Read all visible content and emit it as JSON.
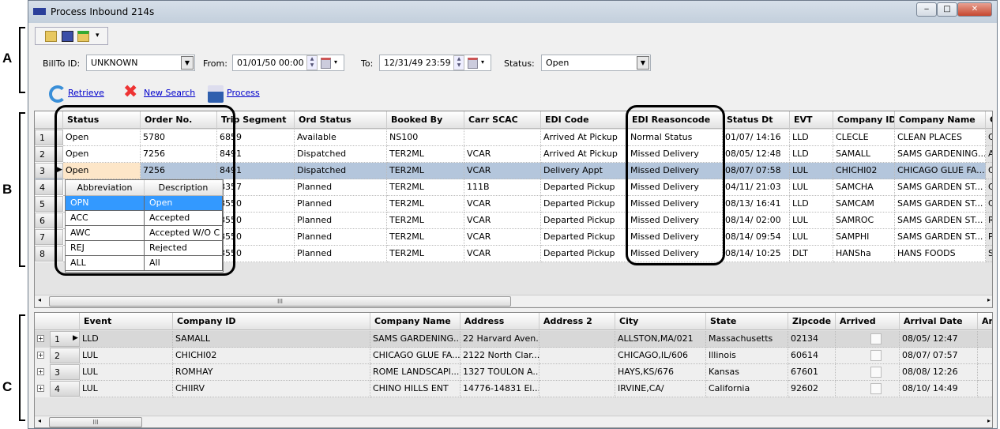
{
  "window": {
    "title": "Process Inbound 214s",
    "logo": "TMW",
    "minimize": "‒",
    "maximize": "□",
    "close": "✕"
  },
  "toolbar": {
    "icons": [
      "new-folder-icon",
      "save-icon",
      "export-icon"
    ],
    "overflow": "▾"
  },
  "filters": {
    "billto_label": "BillTo ID:",
    "billto_value": "UNKNOWN",
    "from_label": "From:",
    "from_value": "01/01/50 00:00",
    "to_label": "To:",
    "to_value": "12/31/49 23:59",
    "status_label": "Status:",
    "status_value": "Open"
  },
  "actions": {
    "retrieve": "Retrieve",
    "new_search": "New Search",
    "process": "Process"
  },
  "annotations": {
    "a": "A",
    "b": "B",
    "c": "C"
  },
  "top_grid": {
    "columns": [
      "Status",
      "Order No.",
      "Trip Segment",
      "Ord Status",
      "Booked By",
      "Carr SCAC",
      "EDI Code",
      "EDI Reasoncode",
      "Status Dt",
      "EVT",
      "Company ID",
      "Company Name",
      "C"
    ],
    "rows": [
      [
        "Open",
        "5780",
        "6859",
        "Available",
        "NS100",
        "",
        "Arrived At Pickup",
        "Normal Status",
        "01/07/ 14:16",
        "LLD",
        "CLECLE",
        "CLEAN PLACES",
        "C"
      ],
      [
        "Open",
        "7256",
        "8491",
        "Dispatched",
        "TER2ML",
        "VCAR",
        "Arrived At Pickup",
        "Missed Delivery",
        "08/05/ 12:48",
        "LLD",
        "SAMALL",
        "SAMS GARDENING...",
        "A"
      ],
      [
        "Open",
        "7256",
        "8491",
        "Dispatched",
        "TER2ML",
        "VCAR",
        "Delivery Appt",
        "Missed Delivery",
        "08/07/ 07:58",
        "LUL",
        "CHICHI02",
        "CHICAGO GLUE FA...",
        "C"
      ],
      [
        "",
        "",
        "8357",
        "Planned",
        "TER2ML",
        "111B",
        "Departed Pickup",
        "Missed Delivery",
        "04/11/ 21:03",
        "LUL",
        "SAMCHA",
        "SAMS GARDEN ST...",
        "C"
      ],
      [
        "",
        "",
        "8550",
        "Planned",
        "TER2ML",
        "VCAR",
        "Departed Pickup",
        "Missed Delivery",
        "08/13/ 16:41",
        "LLD",
        "SAMCAM",
        "SAMS GARDEN ST...",
        "C"
      ],
      [
        "",
        "",
        "8550",
        "Planned",
        "TER2ML",
        "VCAR",
        "Departed Pickup",
        "Missed Delivery",
        "08/14/ 02:00",
        "LUL",
        "SAMROC",
        "SAMS GARDEN ST...",
        "R"
      ],
      [
        "",
        "",
        "8550",
        "Planned",
        "TER2ML",
        "VCAR",
        "Departed Pickup",
        "Missed Delivery",
        "08/14/ 09:54",
        "LUL",
        "SAMPHI",
        "SAMS GARDEN ST...",
        "P"
      ],
      [
        "",
        "",
        "8550",
        "Planned",
        "TER2ML",
        "VCAR",
        "Departed Pickup",
        "Missed Delivery",
        "08/14/ 10:25",
        "DLT",
        "HANSha",
        "HANS FOODS",
        "S"
      ]
    ],
    "row_numbers": [
      "1",
      "2",
      "3",
      "4",
      "5",
      "6",
      "7",
      "8"
    ],
    "selected_row": 3
  },
  "status_dropdown": {
    "headers": [
      "Abbreviation",
      "Description"
    ],
    "options": [
      [
        "OPN",
        "Open"
      ],
      [
        "ACC",
        "Accepted"
      ],
      [
        "AWC",
        "Accepted W/O C"
      ],
      [
        "REJ",
        "Rejected"
      ],
      [
        "ALL",
        "All"
      ]
    ],
    "selected": "OPN"
  },
  "bottom_grid": {
    "columns": [
      "Event",
      "Company ID",
      "Company Name",
      "Address",
      "Address 2",
      "City",
      "State",
      "Zipcode",
      "Arrived",
      "Arrival Date",
      "Ar"
    ],
    "rows": [
      [
        "LLD",
        "SAMALL",
        "SAMS GARDENING...",
        "22 Harvard Aven...",
        "",
        "ALLSTON,MA/021",
        "Massachusetts",
        "02134",
        "",
        "08/05/ 12:47",
        ""
      ],
      [
        "LUL",
        "CHICHI02",
        "CHICAGO GLUE FA...",
        "2122 North Clar...",
        "",
        "CHICAGO,IL/606",
        "Illinois",
        "60614",
        "",
        "08/07/ 07:57",
        ""
      ],
      [
        "LUL",
        "ROMHAY",
        "ROME LANDSCAPI...",
        "1327 TOULON A...",
        "",
        "HAYS,KS/676",
        "Kansas",
        "67601",
        "",
        "08/08/ 12:26",
        ""
      ],
      [
        "LUL",
        "CHIIRV",
        "CHINO HILLS ENT",
        "14776-14831 El...",
        "",
        "IRVINE,CA/",
        "California",
        "92602",
        "",
        "08/10/ 14:49",
        ""
      ]
    ],
    "row_numbers": [
      "1",
      "2",
      "3",
      "4"
    ],
    "arrived": [
      false,
      false,
      false,
      false
    ]
  },
  "scrollbar": {
    "grip": "III"
  }
}
